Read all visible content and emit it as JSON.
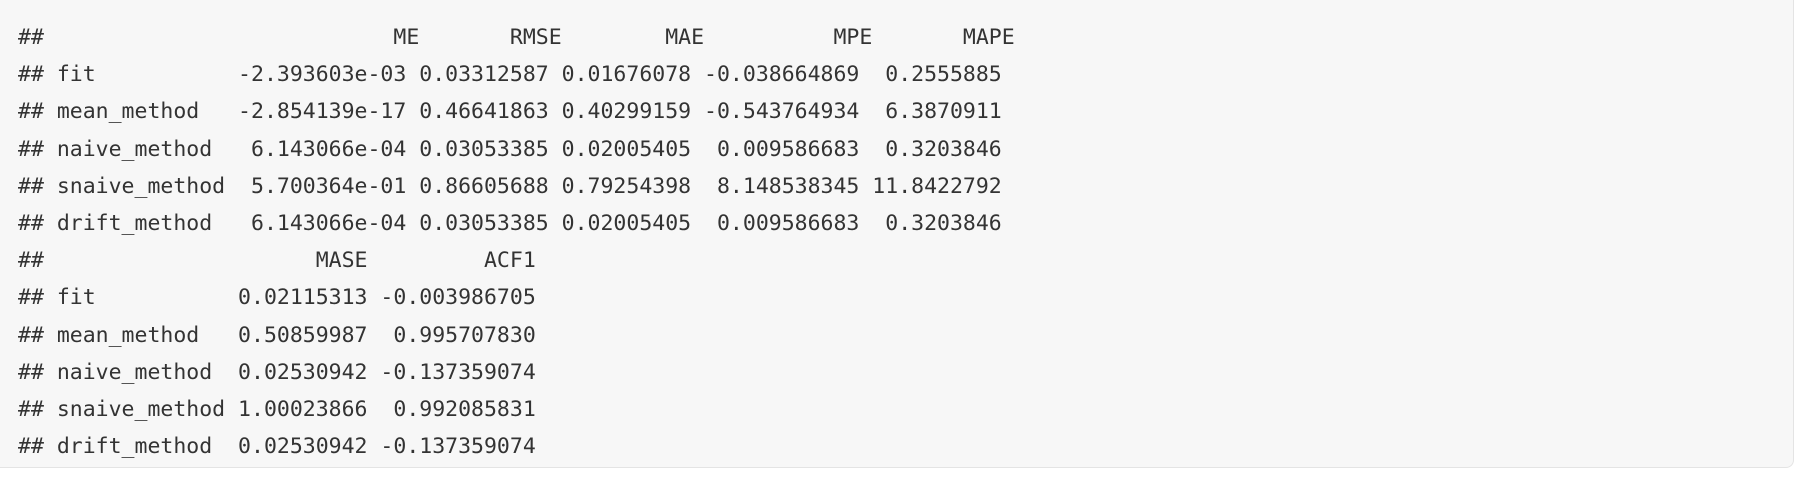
{
  "console_output": {
    "lines": [
      "##                           ME       RMSE        MAE          MPE       MAPE",
      "## fit           -2.393603e-03 0.03312587 0.01676078 -0.038664869  0.2555885",
      "## mean_method   -2.854139e-17 0.46641863 0.40299159 -0.543764934  6.3870911",
      "## naive_method   6.143066e-04 0.03053385 0.02005405  0.009586683  0.3203846",
      "## snaive_method  5.700364e-01 0.86605688 0.79254398  8.148538345 11.8422792",
      "## drift_method   6.143066e-04 0.03053385 0.02005405  0.009586683  0.3203846",
      "##                     MASE         ACF1",
      "## fit           0.02115313 -0.003986705",
      "## mean_method   0.50859987  0.995707830",
      "## naive_method  0.02530942 -0.137359074",
      "## snaive_method 1.00023866  0.992085831",
      "## drift_method  0.02530942 -0.137359074"
    ]
  }
}
